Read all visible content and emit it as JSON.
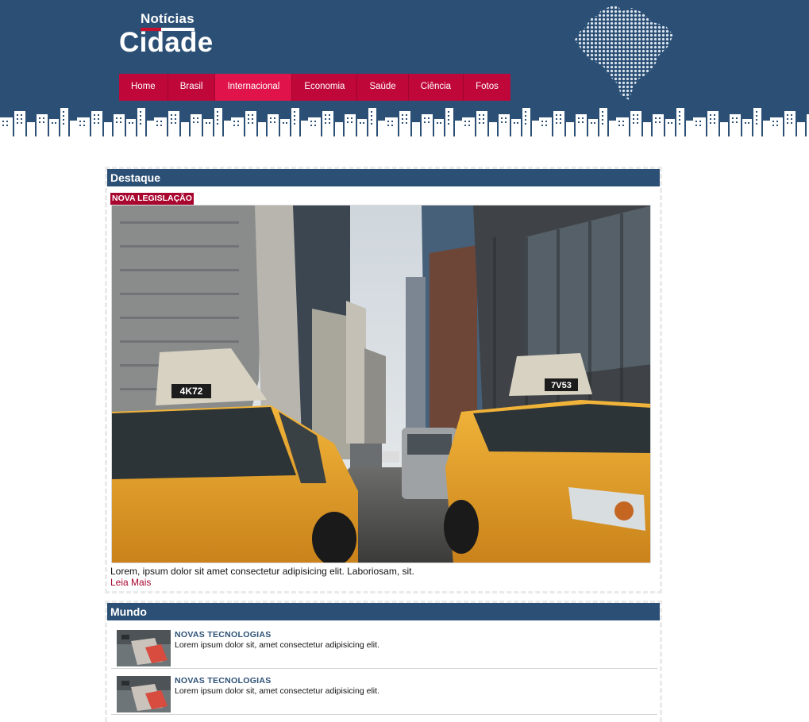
{
  "header": {
    "logo_small": "Notícias",
    "logo_big": "Cidade",
    "nav": [
      "Home",
      "Brasil",
      "Internacional",
      "Economia",
      "Saúde",
      "Ciência",
      "Fotos"
    ],
    "nav_active": "Internacional"
  },
  "colors": {
    "header_bg": "#2c5075",
    "nav_bg": "#c0073a",
    "nav_active": "#e0134b",
    "accent_red": "#a8052f"
  },
  "featured": {
    "title": "Destaque",
    "tag": "NOVA LEGISLAÇÃO",
    "summary": "Lorem, ipsum dolor sit amet consectetur adipisicing elit. Laboriosam, sit.",
    "read_more": "Leia Mais",
    "taxi_plates": [
      "4K72",
      "7V53"
    ]
  },
  "world": {
    "title": "Mundo",
    "items": [
      {
        "category": "NOVAS TECNOLOGIAS",
        "text": "Lorem ipsum dolor sit, amet consectetur adipisicing elit."
      },
      {
        "category": "NOVAS TECNOLOGIAS",
        "text": "Lorem ipsum dolor sit, amet consectetur adipisicing elit."
      }
    ]
  }
}
